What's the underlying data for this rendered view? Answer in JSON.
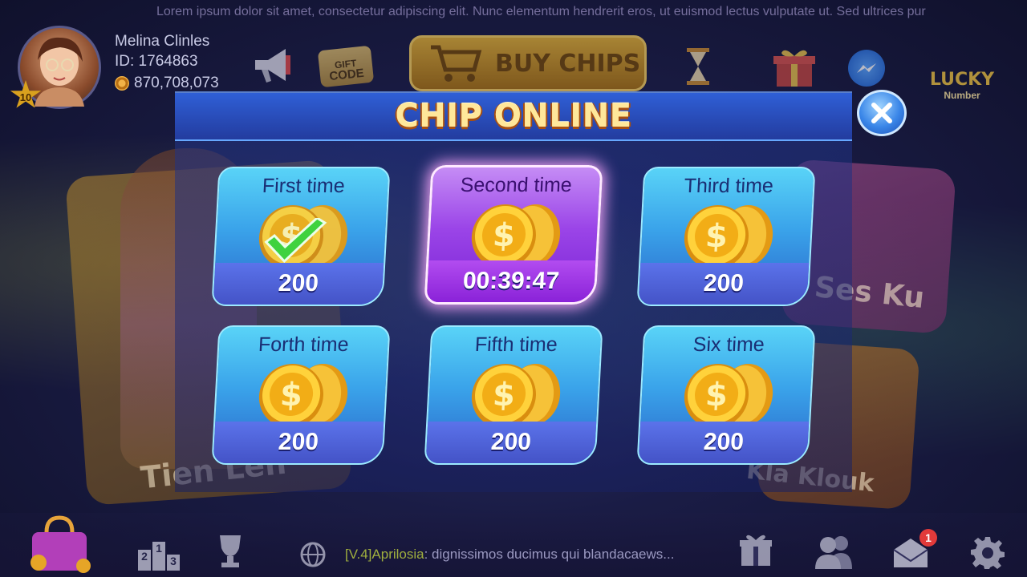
{
  "marquee": {
    "text": "Lorem ipsum dolor sit amet, consectetur adipiscing elit. Nunc elementum hendrerit eros, ut euismod lectus vulputate ut. Sed ultrices pur"
  },
  "user": {
    "name": "Melina Clinles",
    "id": "ID: 1764863",
    "chips": "870,708,073",
    "level": "10"
  },
  "toolbar": {
    "gift_code_line1": "GIFT",
    "gift_code_line2": "CODE",
    "buy_chips": "BUY CHIPS",
    "lucky_line1": "LUCKY",
    "lucky_line2": "Number"
  },
  "background_games": {
    "left": "Tien Len",
    "right_top": "Ses Ku",
    "right_bottom": "Kla Klouk"
  },
  "modal": {
    "title": "CHIP ONLINE",
    "rewards": [
      {
        "label": "First time",
        "value": "200",
        "state": "claimed"
      },
      {
        "label": "Second time",
        "value": "00:39:47",
        "state": "countdown"
      },
      {
        "label": "Third time",
        "value": "200",
        "state": "locked"
      },
      {
        "label": "Forth time",
        "value": "200",
        "state": "locked"
      },
      {
        "label": "Fifth time",
        "value": "200",
        "state": "locked"
      },
      {
        "label": "Six time",
        "value": "200",
        "state": "locked"
      }
    ]
  },
  "bottom_bar": {
    "chat_tag": "[V.4]Aprilosia",
    "chat_message": ": dignissimos ducimus qui blandacaews...",
    "mail_badge": "1",
    "ranking_digits": [
      "2",
      "1",
      "3"
    ]
  },
  "colors": {
    "modal_title": "#ffe79a",
    "active_card": "#9b45e8",
    "card": "#3aa3ea",
    "close_button": "#3a86e8"
  }
}
